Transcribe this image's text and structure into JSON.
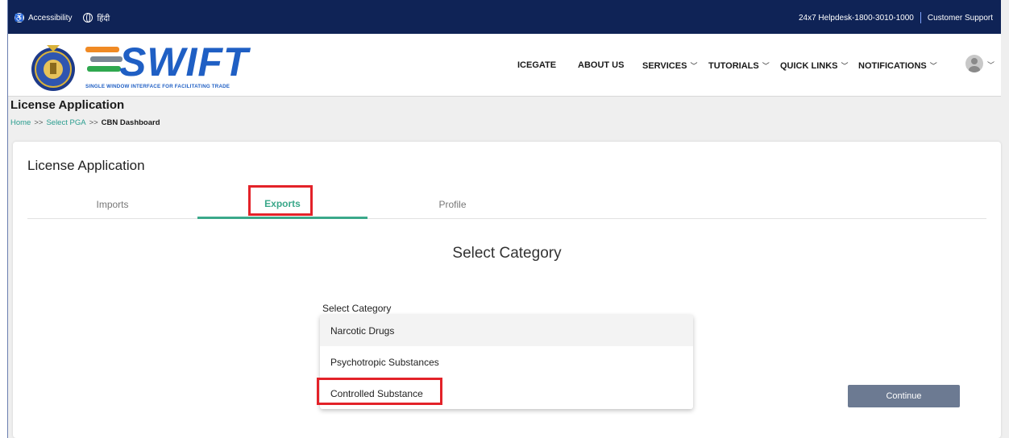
{
  "topbar": {
    "accessibility": "Accessibility",
    "language": "हिंदी",
    "helpdesk": "24x7 Helpdesk-1800-3010-1000",
    "support": "Customer Support"
  },
  "header": {
    "logo_text": "SWIFT",
    "logo_sub": "SINGLE WINDOW INTERFACE FOR FACILITATING TRADE",
    "nav": [
      {
        "label": "ICEGATE"
      },
      {
        "label": "ABOUT US"
      },
      {
        "label": "SERVICES"
      },
      {
        "label": "TUTORIALS"
      },
      {
        "label": "QUICK LINKS"
      },
      {
        "label": "NOTIFICATIONS"
      }
    ]
  },
  "page": {
    "title": "License Application",
    "breadcrumb": [
      "Home",
      "Select PGA",
      "CBN Dashboard"
    ],
    "breadcrumb_sep": ">>"
  },
  "card": {
    "title": "License Application",
    "tabs": [
      {
        "label": "Imports"
      },
      {
        "label": "Exports",
        "active": true
      },
      {
        "label": "Profile"
      }
    ],
    "section_title": "Select Category",
    "select_label": "Select Category",
    "options": [
      "Narcotic Drugs",
      "Psychotropic Substances",
      "Controlled Substance"
    ],
    "continue_label": "Continue"
  },
  "colors": {
    "topbar": "#0f2356",
    "accent": "#3aa88a",
    "highlight": "#e32229",
    "button": "#6c7a92",
    "logo": "#1f5fc4"
  }
}
